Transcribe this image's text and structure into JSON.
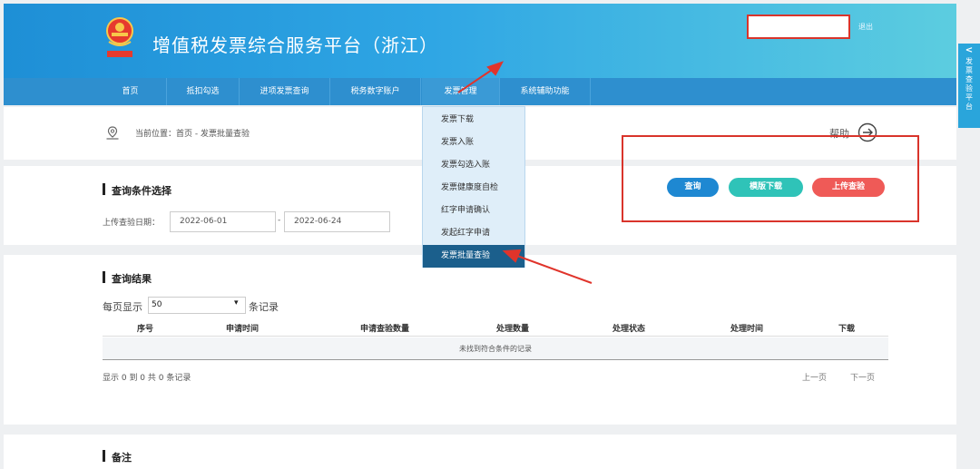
{
  "header": {
    "title": "增值税发票综合服务平台（浙江）",
    "logout": "退出",
    "emblem_icon": "tax-emblem-icon",
    "emblem_caption": "中国税务"
  },
  "nav": {
    "items": [
      "首页",
      "抵扣勾选",
      "进项发票查询",
      "税务数字账户",
      "发票管理",
      "系统辅助功能"
    ]
  },
  "float_tab": {
    "chevron": "<",
    "text": "发票查验平台"
  },
  "breadcrumb": {
    "label": "当前位置：首页 - 发票批量查验"
  },
  "help": {
    "label": "帮助"
  },
  "query": {
    "section_title": "查询条件选择",
    "date_label": "上传查验日期：",
    "start_date": "2022-06-01",
    "dash": "-",
    "end_date": "2022-06-24",
    "buttons": {
      "search": "查询",
      "template": "模版下载",
      "upload": "上传查验"
    },
    "colors": {
      "search": "#1e88d2",
      "template": "#2fc3b8",
      "upload": "#ef5a57"
    }
  },
  "results": {
    "section_title": "查询结果",
    "per_page_label": "每页显示",
    "per_page_value": "50",
    "records_word": "条记录",
    "columns": [
      "序号",
      "申请时间",
      "申请查验数量",
      "处理数量",
      "处理状态",
      "处理时间",
      "下载"
    ],
    "empty_text": "未找到符合条件的记录",
    "summary": "显示 0 到 0 共 0 条记录",
    "prev": "上一页",
    "next": "下一页"
  },
  "notes": {
    "section_title": "备注"
  },
  "dropdown": {
    "items": [
      "发票下载",
      "发票入账",
      "发票勾选入账",
      "发票健康度自检",
      "红字申请确认",
      "发起红字申请",
      "发票批量查验"
    ],
    "active_index": 6
  },
  "annotation_color": "#d9342b"
}
